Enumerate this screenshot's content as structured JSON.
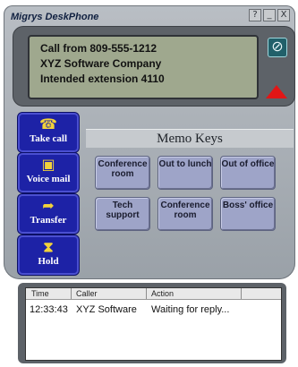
{
  "window": {
    "title": "Migrys DeskPhone",
    "buttons": [
      "?",
      "_",
      "X"
    ]
  },
  "display": {
    "lines": [
      "Call from 809-555-1212",
      "XYZ Software Company",
      "Intended extension 4110"
    ],
    "mute_icon_symbol": "⊘",
    "accent": "#e11616"
  },
  "actions": [
    {
      "label": "Take call",
      "icon": "handset-icon",
      "glyph": "☎"
    },
    {
      "label": "Voice mail",
      "icon": "cassette-icon",
      "glyph": "▣"
    },
    {
      "label": "Transfer",
      "icon": "transfer-icon",
      "glyph": "➦"
    },
    {
      "label": "Hold",
      "icon": "hourglass-icon",
      "glyph": "⧗"
    }
  ],
  "memo": {
    "title": "Memo Keys",
    "keys": [
      {
        "label": "Conference room"
      },
      {
        "label": "Out to lunch"
      },
      {
        "label": "Out of office"
      },
      {
        "label": "Tech support"
      },
      {
        "label": "Conference room"
      },
      {
        "label": "Boss' office"
      }
    ]
  },
  "log": {
    "columns": [
      "Time",
      "Caller",
      "Action"
    ],
    "rows": [
      {
        "time": "12:33:43",
        "caller": "XYZ Software",
        "action": "Waiting for reply..."
      }
    ]
  }
}
